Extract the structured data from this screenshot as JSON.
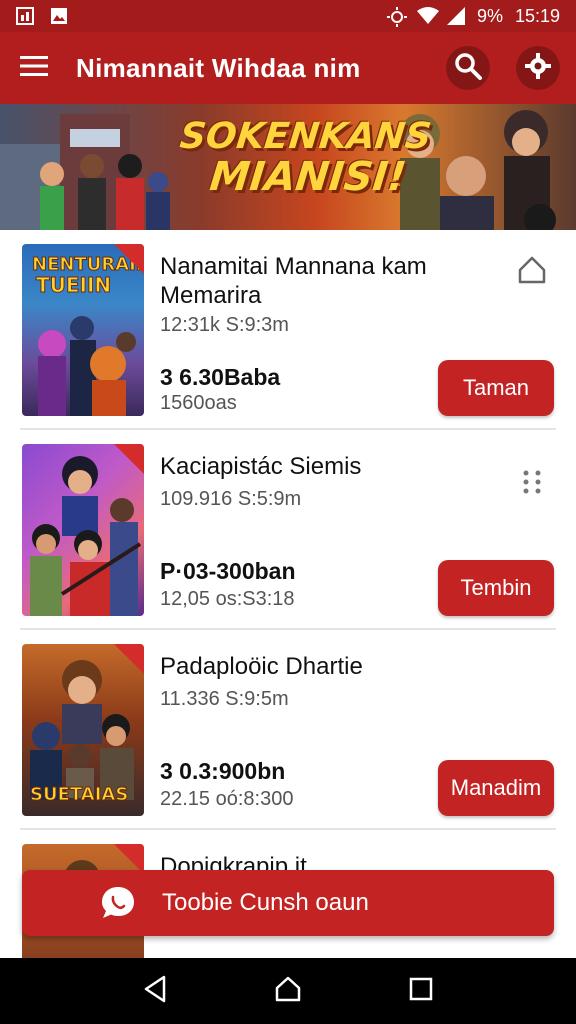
{
  "status_bar": {
    "battery_text": "9%",
    "time": "15:19"
  },
  "app_bar": {
    "title": "Nimannait Wihdaa nim"
  },
  "banner": {
    "line1": "SOKENKANS",
    "line2": "MIANISI!"
  },
  "items": [
    {
      "title": "Nanamitai Mannana kam Memarira",
      "meta": "12:31k S:9:3m",
      "price": "3 6.30Baba",
      "sub": "1560oas",
      "button": "Taman",
      "side_icon": "home-outline-icon"
    },
    {
      "title": "Kaciapistác Siemis",
      "meta": "109.916 S:5:9m",
      "price": "P·03-300ban",
      "sub": "12,05 os:S3:18",
      "button": "Tembin",
      "side_icon": "more-grid-icon"
    },
    {
      "title": "Padaploöic Dhartie",
      "meta": "11.336 S:9:5m",
      "price": "3 0.3:900bn",
      "sub": "22.15 oó:8:300",
      "button": "Manadim"
    },
    {
      "title": "Dopiqkrapip it"
    }
  ],
  "cta": {
    "label": "Toobie Cunsh oaun"
  },
  "colors": {
    "primary": "#b21e1e",
    "button": "#c42323",
    "status": "#a31b1b"
  }
}
